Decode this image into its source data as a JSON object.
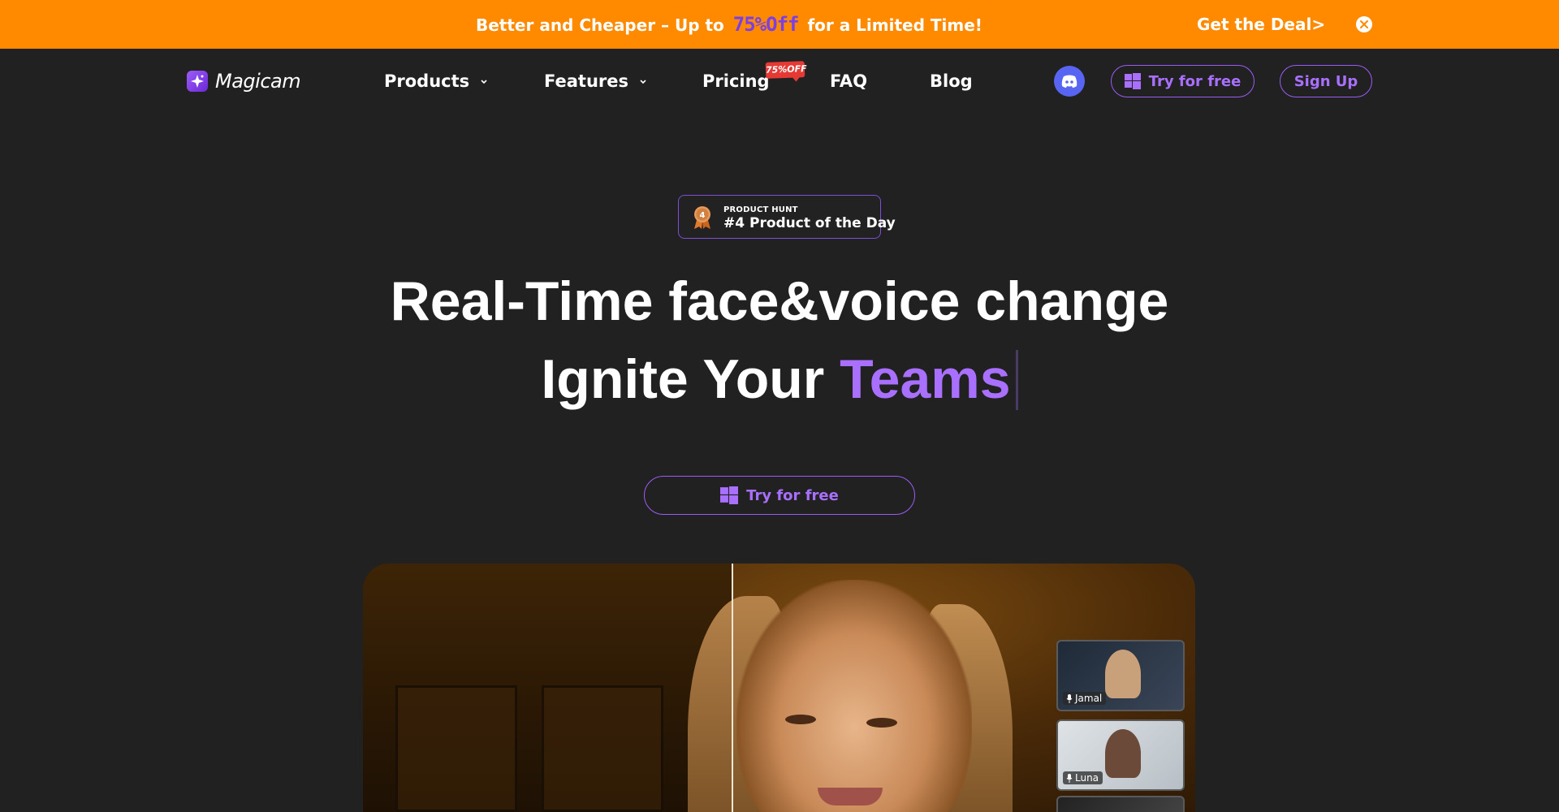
{
  "banner": {
    "message_before": "Better and Cheaper – Up to",
    "discount": "75%Off",
    "message_after": "for a Limited Time!",
    "cta": "Get the Deal>"
  },
  "nav": {
    "logo": "Magicam",
    "items": [
      {
        "label": "Products",
        "has_dropdown": true
      },
      {
        "label": "Features",
        "has_dropdown": true
      },
      {
        "label": "Pricing",
        "has_dropdown": false
      },
      {
        "label": "FAQ",
        "has_dropdown": false
      },
      {
        "label": "Blog",
        "has_dropdown": false
      }
    ],
    "pricing_badge": "75%OFF",
    "try_label": "Try for free",
    "signup_label": "Sign Up"
  },
  "hero": {
    "badge_small": "PRODUCT HUNT",
    "badge_big": "#4 Product of the Day",
    "medal_number": "4",
    "headline_line1": "Real-Time face&voice change",
    "headline_line2_prefix": "Ignite Your",
    "headline_line2_accent": "Teams",
    "cta_label": "Try for free"
  },
  "video": {
    "participants": [
      {
        "name": "Jamal"
      },
      {
        "name": "Luna"
      }
    ]
  },
  "colors": {
    "banner_bg": "#FF8A00",
    "page_bg": "#212121",
    "accent": "#A970FF",
    "discord": "#5865F2",
    "badge_red": "#E53935"
  }
}
